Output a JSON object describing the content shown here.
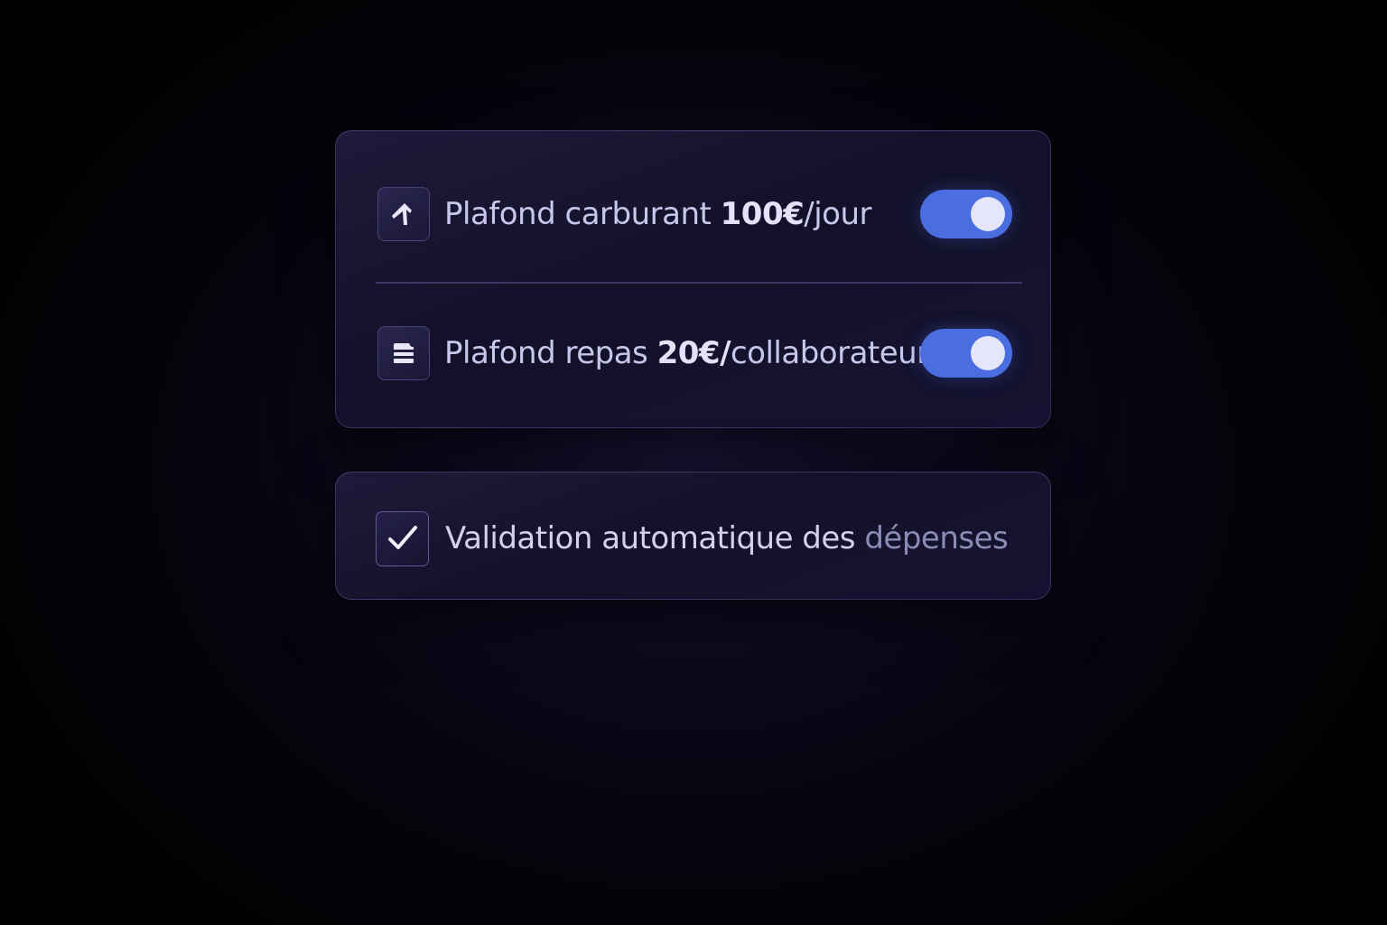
{
  "limits_card": {
    "fuel": {
      "icon": "fuel-route-icon",
      "label_prefix": "Plafond carburant ",
      "label_amount": "100€",
      "label_suffix": "/jour",
      "enabled": true
    },
    "meal": {
      "icon": "meal-stack-icon",
      "label_prefix": "Plafond repas ",
      "label_amount": "20€/",
      "label_suffix": "collaborateur",
      "enabled": true
    }
  },
  "validation_card": {
    "checked": true,
    "label_main": "Validation automatique des ",
    "label_faded": "dépenses"
  },
  "colors": {
    "toggle_on": "#4a6ee0",
    "knob": "#e6e6fb",
    "card_bg": "#141230",
    "text": "#c8c6ea"
  }
}
